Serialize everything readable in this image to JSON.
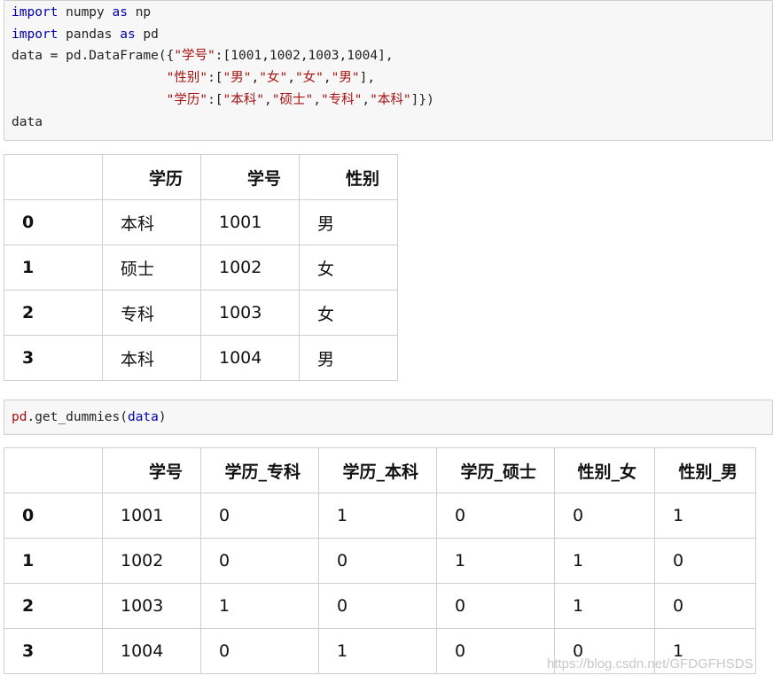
{
  "cell1": {
    "lines": [
      [
        {
          "t": "import",
          "c": "kw"
        },
        {
          "t": " numpy ",
          "c": "var"
        },
        {
          "t": "as",
          "c": "kw"
        },
        {
          "t": " np",
          "c": "var"
        }
      ],
      [
        {
          "t": "import",
          "c": "kw"
        },
        {
          "t": " pandas ",
          "c": "var"
        },
        {
          "t": "as",
          "c": "kw"
        },
        {
          "t": " pd",
          "c": "var"
        }
      ],
      [
        {
          "t": "data = pd.DataFrame({",
          "c": "var"
        },
        {
          "t": "\"学号\"",
          "c": "str"
        },
        {
          "t": ":[1001,1002,1003,1004],",
          "c": "var"
        }
      ],
      [
        {
          "t": "                    ",
          "c": "var"
        },
        {
          "t": "\"性别\"",
          "c": "str"
        },
        {
          "t": ":[",
          "c": "var"
        },
        {
          "t": "\"男\"",
          "c": "str"
        },
        {
          "t": ",",
          "c": "var"
        },
        {
          "t": "\"女\"",
          "c": "str"
        },
        {
          "t": ",",
          "c": "var"
        },
        {
          "t": "\"女\"",
          "c": "str"
        },
        {
          "t": ",",
          "c": "var"
        },
        {
          "t": "\"男\"",
          "c": "str"
        },
        {
          "t": "],",
          "c": "var"
        }
      ],
      [
        {
          "t": "                    ",
          "c": "var"
        },
        {
          "t": "\"学历\"",
          "c": "str"
        },
        {
          "t": ":[",
          "c": "var"
        },
        {
          "t": "\"本科\"",
          "c": "str"
        },
        {
          "t": ",",
          "c": "var"
        },
        {
          "t": "\"硕士\"",
          "c": "str"
        },
        {
          "t": ",",
          "c": "var"
        },
        {
          "t": "\"专科\"",
          "c": "str"
        },
        {
          "t": ",",
          "c": "var"
        },
        {
          "t": "\"本科\"",
          "c": "str"
        },
        {
          "t": "]})",
          "c": "var"
        }
      ],
      [
        {
          "t": "data",
          "c": "var"
        }
      ]
    ]
  },
  "table1": {
    "columns": [
      "",
      "学历",
      "学号",
      "性别"
    ],
    "rows": [
      {
        "index": "0",
        "cells": [
          "本科",
          "1001",
          "男"
        ]
      },
      {
        "index": "1",
        "cells": [
          "硕士",
          "1002",
          "女"
        ]
      },
      {
        "index": "2",
        "cells": [
          "专科",
          "1003",
          "女"
        ]
      },
      {
        "index": "3",
        "cells": [
          "本科",
          "1004",
          "男"
        ]
      }
    ]
  },
  "cell2": {
    "lines": [
      [
        {
          "t": "pd",
          "c": "str"
        },
        {
          "t": ".get_dummies(",
          "c": "var"
        },
        {
          "t": "data",
          "c": "kw"
        },
        {
          "t": ")",
          "c": "var"
        }
      ]
    ]
  },
  "table2": {
    "columns": [
      "",
      "学号",
      "学历_专科",
      "学历_本科",
      "学历_硕士",
      "性别_女",
      "性别_男"
    ],
    "rows": [
      {
        "index": "0",
        "cells": [
          "1001",
          "0",
          "1",
          "0",
          "0",
          "1"
        ]
      },
      {
        "index": "1",
        "cells": [
          "1002",
          "0",
          "0",
          "1",
          "1",
          "0"
        ]
      },
      {
        "index": "2",
        "cells": [
          "1003",
          "1",
          "0",
          "0",
          "1",
          "0"
        ]
      },
      {
        "index": "3",
        "cells": [
          "1004",
          "0",
          "1",
          "0",
          "0",
          "1"
        ]
      }
    ]
  },
  "watermark": "https://blog.csdn.net/GFDGFHSDS"
}
